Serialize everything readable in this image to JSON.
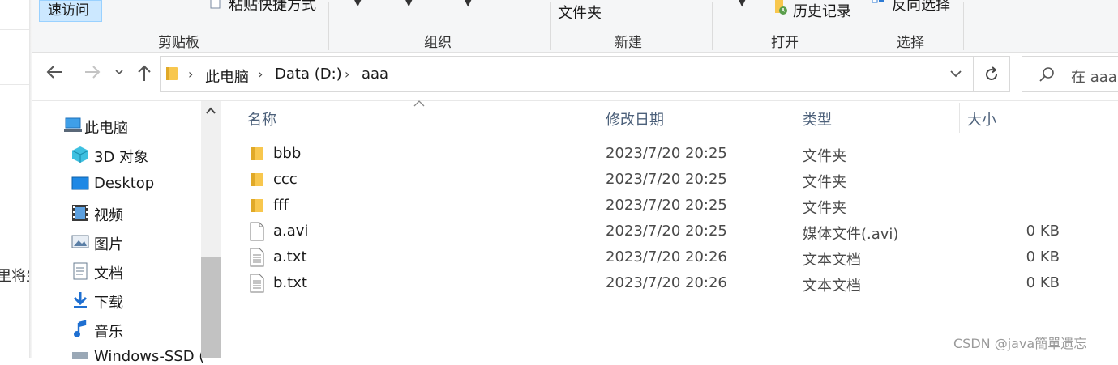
{
  "background_window": {
    "text": "里将生"
  },
  "ribbon": {
    "quick_access_label": "速访问",
    "paste_shortcut_label": "粘贴快捷方式",
    "new_folder_label": "文件夹",
    "history_label": "历史记录",
    "invert_selection_label": "反向选择",
    "groups": {
      "clipboard": "剪贴板",
      "organize": "组织",
      "new": "新建",
      "open": "打开",
      "select": "选择"
    }
  },
  "address": {
    "breadcrumbs": [
      "此电脑",
      "Data (D:)",
      "aaa"
    ],
    "search_placeholder": "在 aaa"
  },
  "nav": {
    "items": [
      {
        "label": "此电脑",
        "icon": "computer-icon"
      },
      {
        "label": "3D 对象",
        "icon": "3d-objects-icon"
      },
      {
        "label": "Desktop",
        "icon": "desktop-icon"
      },
      {
        "label": "视频",
        "icon": "videos-icon"
      },
      {
        "label": "图片",
        "icon": "pictures-icon"
      },
      {
        "label": "文档",
        "icon": "documents-icon"
      },
      {
        "label": "下载",
        "icon": "downloads-icon"
      },
      {
        "label": "音乐",
        "icon": "music-icon"
      },
      {
        "label": "Windows-SSD (",
        "icon": "drive-icon"
      }
    ]
  },
  "columns": {
    "name": "名称",
    "modified": "修改日期",
    "type": "类型",
    "size": "大小"
  },
  "files": [
    {
      "name": "bbb",
      "modified": "2023/7/20 20:25",
      "type": "文件夹",
      "size": "",
      "icon": "folder-icon"
    },
    {
      "name": "ccc",
      "modified": "2023/7/20 20:25",
      "type": "文件夹",
      "size": "",
      "icon": "folder-icon"
    },
    {
      "name": "fff",
      "modified": "2023/7/20 20:25",
      "type": "文件夹",
      "size": "",
      "icon": "folder-icon"
    },
    {
      "name": "a.avi",
      "modified": "2023/7/20 20:25",
      "type": "媒体文件(.avi)",
      "size": "0 KB",
      "icon": "blank-file-icon"
    },
    {
      "name": "a.txt",
      "modified": "2023/7/20 20:26",
      "type": "文本文档",
      "size": "0 KB",
      "icon": "text-file-icon"
    },
    {
      "name": "b.txt",
      "modified": "2023/7/20 20:26",
      "type": "文本文档",
      "size": "0 KB",
      "icon": "text-file-icon"
    }
  ],
  "watermark": "CSDN @java簡單遗忘",
  "colors": {
    "folder": "#f8c74e",
    "selection": "#cce8ff",
    "header_text": "#4c607a"
  }
}
